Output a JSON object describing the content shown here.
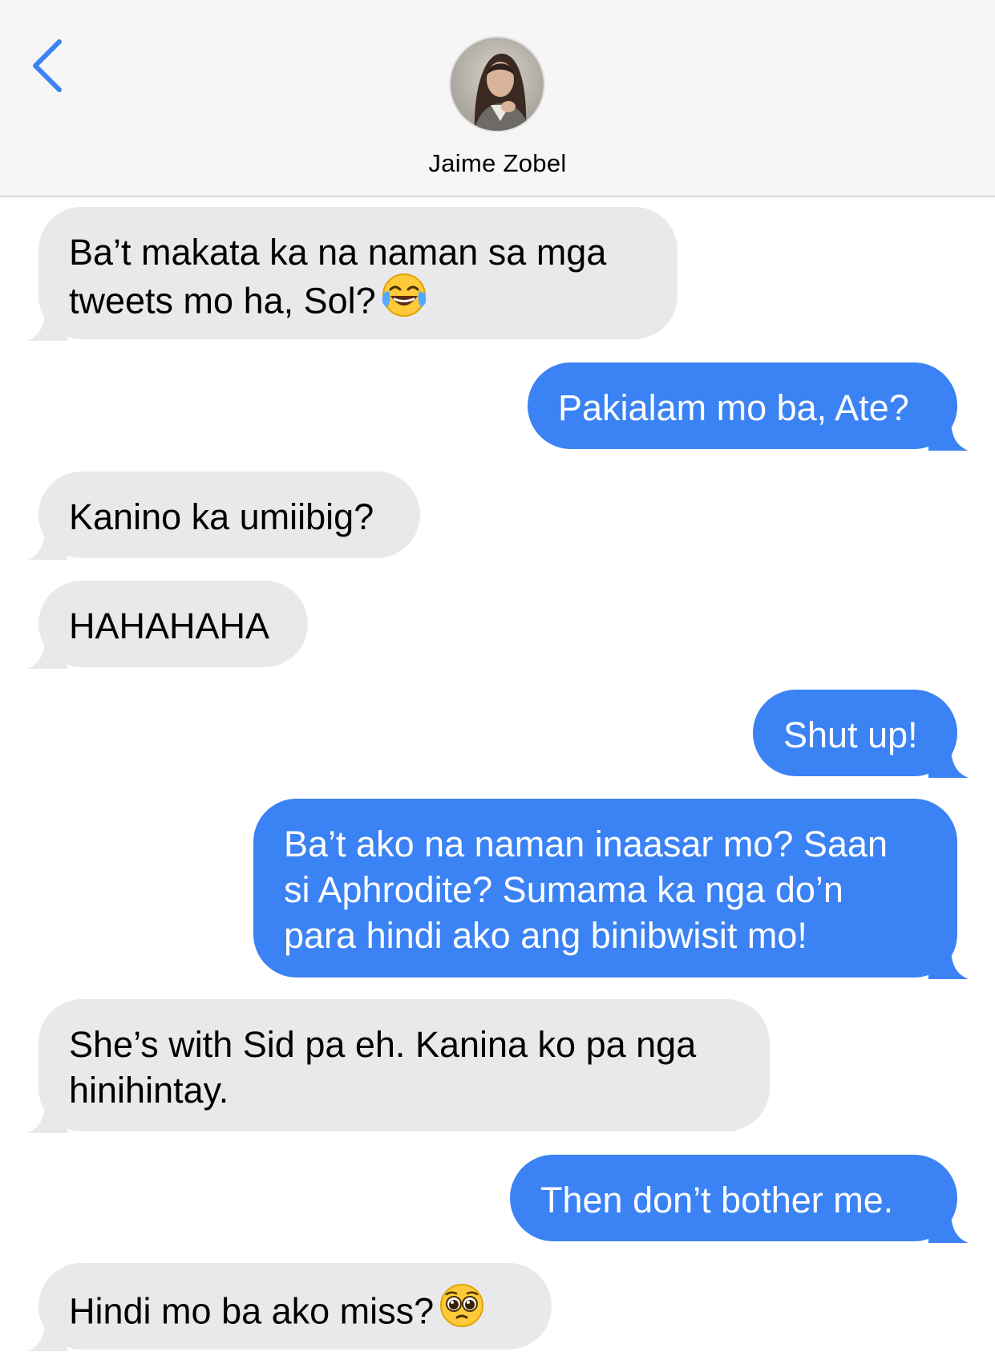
{
  "header": {
    "contact_name": "Jaime Zobel",
    "back_icon": "chevron-left-icon",
    "colors": {
      "back": "#3b82f4",
      "background": "#f6f6f6"
    }
  },
  "messages": [
    {
      "direction": "incoming",
      "text": "Ba’t makata ka na naman sa mga\ntweets mo ha, Sol?",
      "emoji": "face-with-tears-of-joy"
    },
    {
      "direction": "outgoing",
      "text": "Pakialam mo ba, Ate?"
    },
    {
      "direction": "incoming",
      "text": "Kanino ka umiibig?"
    },
    {
      "direction": "incoming",
      "text": "HAHAHAHA"
    },
    {
      "direction": "outgoing",
      "text": "Shut up!"
    },
    {
      "direction": "outgoing",
      "text": "Ba’t ako na naman inaasar mo? Saan\nsi Aphrodite? Sumama ka nga do’n\npara hindi ako ang binibwisit mo!"
    },
    {
      "direction": "incoming",
      "text": "She’s with Sid pa eh. Kanina ko pa nga\nhinihintay."
    },
    {
      "direction": "outgoing",
      "text": "Then don’t bother me."
    },
    {
      "direction": "incoming",
      "text": "Hindi mo ba ako miss?",
      "emoji": "pleading-face"
    }
  ],
  "colors": {
    "incoming_bubble": "#e9e9eb",
    "outgoing_bubble": "#3b82f4",
    "outgoing_text": "#ffffff"
  }
}
